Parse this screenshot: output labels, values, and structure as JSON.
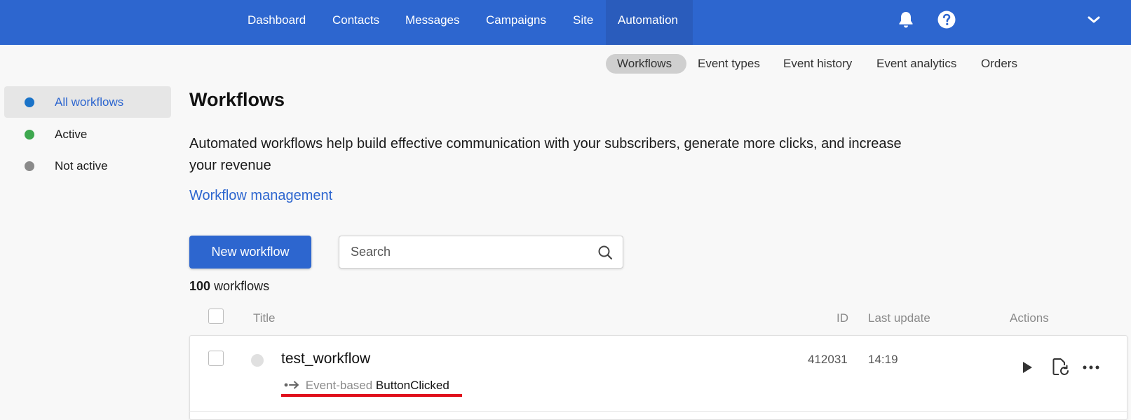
{
  "colors": {
    "brand": "#2d66cf",
    "active_dot": "#1a73c8",
    "active_status": "#3ea84f",
    "inactive_status": "#8a8a8a",
    "highlight": "#e0101b"
  },
  "topnav": {
    "items": [
      {
        "label": "Dashboard"
      },
      {
        "label": "Contacts"
      },
      {
        "label": "Messages"
      },
      {
        "label": "Campaigns"
      },
      {
        "label": "Site"
      },
      {
        "label": "Automation",
        "active": true
      }
    ],
    "icons": [
      "bell-icon",
      "help-icon",
      "chevron-down-icon"
    ]
  },
  "subnav": {
    "items": [
      {
        "label": "Workflows",
        "active": true
      },
      {
        "label": "Event types"
      },
      {
        "label": "Event history"
      },
      {
        "label": "Event analytics"
      },
      {
        "label": "Orders"
      }
    ]
  },
  "sidebar": {
    "items": [
      {
        "label": "All workflows",
        "active": true
      },
      {
        "label": "Active"
      },
      {
        "label": "Not active"
      }
    ]
  },
  "main": {
    "title": "Workflows",
    "intro": "Automated workflows help build effective communication with your subscribers, generate more clicks, and increase your revenue",
    "management_link": "Workflow management",
    "new_button": "New workflow",
    "search_placeholder": "Search",
    "count_number": "100",
    "count_label": "workflows"
  },
  "table": {
    "headers": {
      "title": "Title",
      "id": "ID",
      "last_update": "Last update",
      "actions": "Actions"
    },
    "rows": [
      {
        "title": "test_workflow",
        "type_label": "Event-based",
        "event": "ButtonClicked",
        "id": "412031",
        "last_update": "14:19",
        "actions": [
          "play-icon",
          "restore-version-icon",
          "more-icon"
        ]
      }
    ]
  }
}
